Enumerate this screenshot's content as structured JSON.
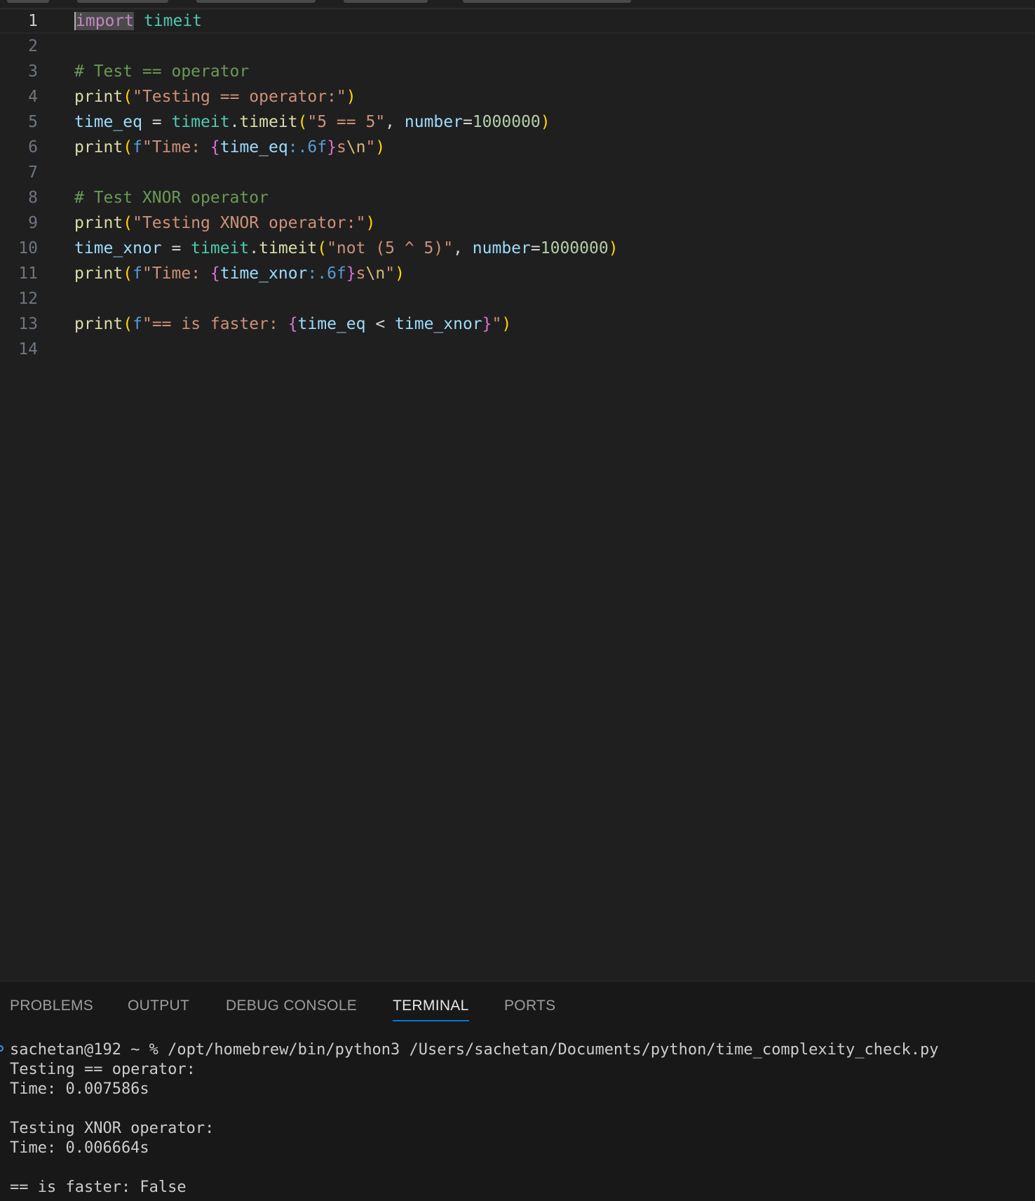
{
  "editor": {
    "lines": [
      {
        "n": "1",
        "tokens": [
          {
            "t": "import",
            "c": "kw-import"
          },
          {
            "t": " ",
            "c": "op"
          },
          {
            "t": "timeit",
            "c": "mod"
          }
        ]
      },
      {
        "n": "2",
        "tokens": []
      },
      {
        "n": "3",
        "tokens": [
          {
            "t": "# Test == operator",
            "c": "cmt"
          }
        ]
      },
      {
        "n": "4",
        "tokens": [
          {
            "t": "print",
            "c": "fn"
          },
          {
            "t": "(",
            "c": "p1"
          },
          {
            "t": "\"Testing == operator:\"",
            "c": "str"
          },
          {
            "t": ")",
            "c": "p1"
          }
        ]
      },
      {
        "n": "5",
        "tokens": [
          {
            "t": "time_eq",
            "c": "var"
          },
          {
            "t": " = ",
            "c": "op"
          },
          {
            "t": "timeit",
            "c": "mod"
          },
          {
            "t": ".",
            "c": "op"
          },
          {
            "t": "timeit",
            "c": "fn"
          },
          {
            "t": "(",
            "c": "p1"
          },
          {
            "t": "\"5 == 5\"",
            "c": "str"
          },
          {
            "t": ", ",
            "c": "op"
          },
          {
            "t": "number",
            "c": "var"
          },
          {
            "t": "=",
            "c": "op"
          },
          {
            "t": "1000000",
            "c": "num"
          },
          {
            "t": ")",
            "c": "p1"
          }
        ]
      },
      {
        "n": "6",
        "tokens": [
          {
            "t": "print",
            "c": "fn"
          },
          {
            "t": "(",
            "c": "p1"
          },
          {
            "t": "f",
            "c": "fpre"
          },
          {
            "t": "\"Time: ",
            "c": "str"
          },
          {
            "t": "{",
            "c": "p2"
          },
          {
            "t": "time_eq",
            "c": "var"
          },
          {
            "t": ":.6f",
            "c": "fpre"
          },
          {
            "t": "}",
            "c": "p2"
          },
          {
            "t": "s",
            "c": "str"
          },
          {
            "t": "\\n",
            "c": "esc"
          },
          {
            "t": "\"",
            "c": "str"
          },
          {
            "t": ")",
            "c": "p1"
          }
        ]
      },
      {
        "n": "7",
        "tokens": []
      },
      {
        "n": "8",
        "tokens": [
          {
            "t": "# Test XNOR operator",
            "c": "cmt"
          }
        ]
      },
      {
        "n": "9",
        "tokens": [
          {
            "t": "print",
            "c": "fn"
          },
          {
            "t": "(",
            "c": "p1"
          },
          {
            "t": "\"Testing XNOR operator:\"",
            "c": "str"
          },
          {
            "t": ")",
            "c": "p1"
          }
        ]
      },
      {
        "n": "10",
        "tokens": [
          {
            "t": "time_xnor",
            "c": "var"
          },
          {
            "t": " = ",
            "c": "op"
          },
          {
            "t": "timeit",
            "c": "mod"
          },
          {
            "t": ".",
            "c": "op"
          },
          {
            "t": "timeit",
            "c": "fn"
          },
          {
            "t": "(",
            "c": "p1"
          },
          {
            "t": "\"not (5 ^ 5)\"",
            "c": "str"
          },
          {
            "t": ", ",
            "c": "op"
          },
          {
            "t": "number",
            "c": "var"
          },
          {
            "t": "=",
            "c": "op"
          },
          {
            "t": "1000000",
            "c": "num"
          },
          {
            "t": ")",
            "c": "p1"
          }
        ]
      },
      {
        "n": "11",
        "tokens": [
          {
            "t": "print",
            "c": "fn"
          },
          {
            "t": "(",
            "c": "p1"
          },
          {
            "t": "f",
            "c": "fpre"
          },
          {
            "t": "\"Time: ",
            "c": "str"
          },
          {
            "t": "{",
            "c": "p2"
          },
          {
            "t": "time_xnor",
            "c": "var"
          },
          {
            "t": ":.6f",
            "c": "fpre"
          },
          {
            "t": "}",
            "c": "p2"
          },
          {
            "t": "s",
            "c": "str"
          },
          {
            "t": "\\n",
            "c": "esc"
          },
          {
            "t": "\"",
            "c": "str"
          },
          {
            "t": ")",
            "c": "p1"
          }
        ]
      },
      {
        "n": "12",
        "tokens": []
      },
      {
        "n": "13",
        "tokens": [
          {
            "t": "print",
            "c": "fn"
          },
          {
            "t": "(",
            "c": "p1"
          },
          {
            "t": "f",
            "c": "fpre"
          },
          {
            "t": "\"== is faster: ",
            "c": "str"
          },
          {
            "t": "{",
            "c": "p2"
          },
          {
            "t": "time_eq",
            "c": "var"
          },
          {
            "t": " < ",
            "c": "op"
          },
          {
            "t": "time_xnor",
            "c": "var"
          },
          {
            "t": "}",
            "c": "p2"
          },
          {
            "t": "\"",
            "c": "str"
          },
          {
            "t": ")",
            "c": "p1"
          }
        ]
      },
      {
        "n": "14",
        "tokens": []
      }
    ]
  },
  "panel": {
    "tabs": [
      {
        "label": "PROBLEMS",
        "active": false
      },
      {
        "label": "OUTPUT",
        "active": false
      },
      {
        "label": "DEBUG CONSOLE",
        "active": false
      },
      {
        "label": "TERMINAL",
        "active": true
      },
      {
        "label": "PORTS",
        "active": false
      }
    ]
  },
  "terminal": {
    "lines": [
      "sachetan@192 ~ % /opt/homebrew/bin/python3 /Users/sachetan/Documents/python/time_complexity_check.py",
      "Testing == operator:",
      "Time: 0.007586s",
      "",
      "Testing XNOR operator:",
      "Time: 0.006664s",
      "",
      "== is faster: False"
    ]
  },
  "colors": {
    "editor_background": "#1f1f1f",
    "panel_background": "#181818",
    "active_tab_underline": "#0078d4"
  }
}
